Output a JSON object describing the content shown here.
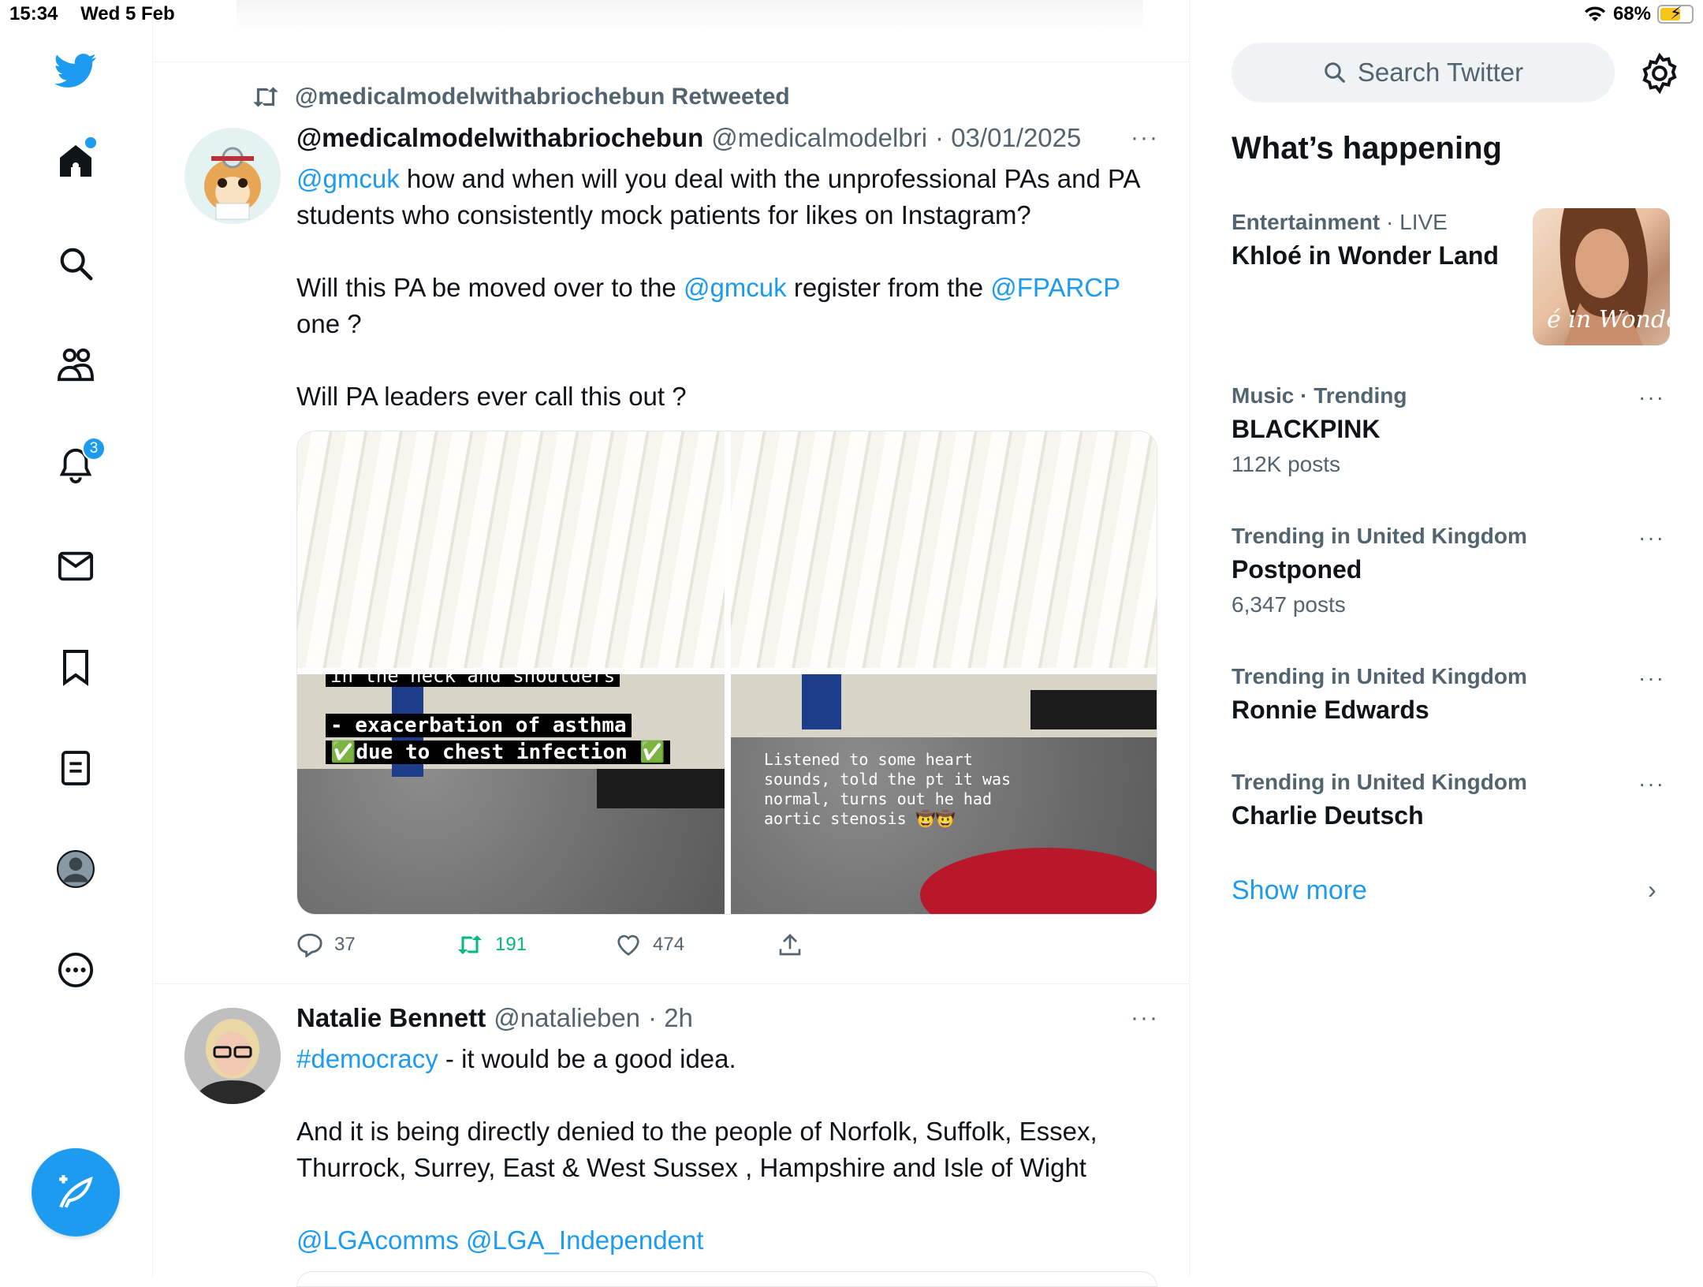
{
  "status_bar": {
    "time": "15:34",
    "date": "Wed 5 Feb",
    "battery": "68%"
  },
  "nav": {
    "notifications_badge": "3"
  },
  "tweet1": {
    "retweet_text": "@medicalmodelwithabriochebun Retweeted",
    "name": "@medicalmodelwithabriochebun",
    "handle": "@medicalmodelbri",
    "date": "· 03/01/2025",
    "more": "···",
    "p1_mention": "@gmcuk",
    "p1_text": " how and when will you deal with the unprofessional PAs and PA students who consistently mock patients for likes on Instagram?",
    "p2_a": "Will this PA be moved over to the ",
    "p2_mention1": "@gmcuk",
    "p2_b": " register from the ",
    "p2_mention2": "@FPARCP",
    "p2_c": " one ?",
    "p3": "Will PA leaders ever call this out ?",
    "media": {
      "img3_line0": "in the neck and shoulders",
      "img3_line1": "- exacerbation of asthma",
      "img3_line2": "due to chest infection",
      "img4_text": "Listened to some heart sounds, told the pt it was normal, turns out he had aortic stenosis",
      "img4_emoji": "🤠🤠"
    },
    "replies": "37",
    "retweets": "191",
    "likes": "474"
  },
  "tweet2": {
    "name": "Natalie Bennett",
    "handle": "@natalieben",
    "time": "· 2h",
    "more": "···",
    "hashtag": "#democracy",
    "p1_text": " - it would be a good idea.",
    "p2": "And it is being directly denied to the people of Norfolk, Suffolk, Essex, Thurrock, Surrey, East & West Sussex , Hampshire and Isle of Wight",
    "p3": "@LGAcomms @LGA_Independent"
  },
  "sidebar": {
    "search_placeholder": "Search Twitter",
    "whats_happening": "What’s happening",
    "trends": [
      {
        "category": "Entertainment",
        "live": " · LIVE",
        "name": "Khloé in Wonder Land",
        "image_text": "é in Wonder L"
      },
      {
        "category": "Music · Trending",
        "name": "BLACKPINK",
        "posts": "112K posts"
      },
      {
        "category": "Trending in United Kingdom",
        "name": "Postponed",
        "posts": "6,347 posts"
      },
      {
        "category": "Trending in United Kingdom",
        "name": "Ronnie Edwards"
      },
      {
        "category": "Trending in United Kingdom",
        "name": "Charlie Deutsch"
      }
    ],
    "show_more": "Show more",
    "more": "···"
  },
  "colors": {
    "accent": "#1d9bf0",
    "retweet_green": "#00ba7c",
    "text": "#0f1419",
    "muted": "#536471"
  }
}
